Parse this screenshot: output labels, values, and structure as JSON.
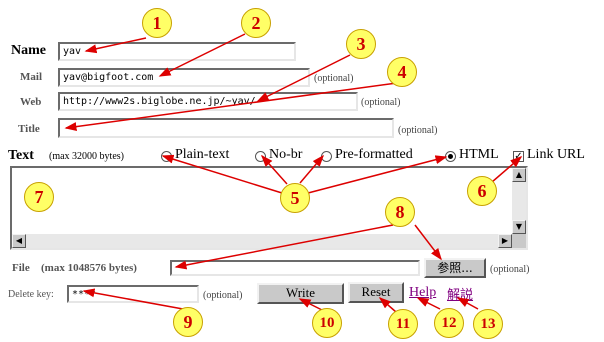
{
  "name": {
    "label": "Name",
    "value": "yav"
  },
  "mail": {
    "label": "Mail",
    "value": "yav@bigfoot.com",
    "optional": "(optional)"
  },
  "web": {
    "label": "Web",
    "value": "http://www2s.biglobe.ne.jp/~yav/",
    "optional": "(optional)"
  },
  "title": {
    "label": "Title",
    "value": "",
    "optional": "(optional)"
  },
  "text": {
    "label": "Text",
    "limit": "(max 32000 bytes)",
    "formats": [
      {
        "label": "Plain-text",
        "checked": false
      },
      {
        "label": "No-br",
        "checked": false
      },
      {
        "label": "Pre-formatted",
        "checked": false
      },
      {
        "label": "HTML",
        "checked": true
      }
    ],
    "link_url": {
      "label": "Link URL",
      "checked": true
    }
  },
  "file": {
    "label": "File",
    "limit": "(max 1048576 bytes)",
    "value": "",
    "browse_label": "参照...",
    "optional": "(optional)"
  },
  "delete_key": {
    "label": "Delete key:",
    "value": "****",
    "optional": "(optional)"
  },
  "buttons": {
    "write": "Write",
    "reset": "Reset"
  },
  "links": {
    "help": "Help",
    "kaisetsu": "解説"
  },
  "callouts": [
    "1",
    "2",
    "3",
    "4",
    "5",
    "6",
    "7",
    "8",
    "9",
    "10",
    "11",
    "12",
    "13"
  ],
  "colors": {
    "callout_fill": "#ffff66",
    "callout_text": "#cc0000",
    "arrow": "#dd0000",
    "link": "#800080"
  }
}
